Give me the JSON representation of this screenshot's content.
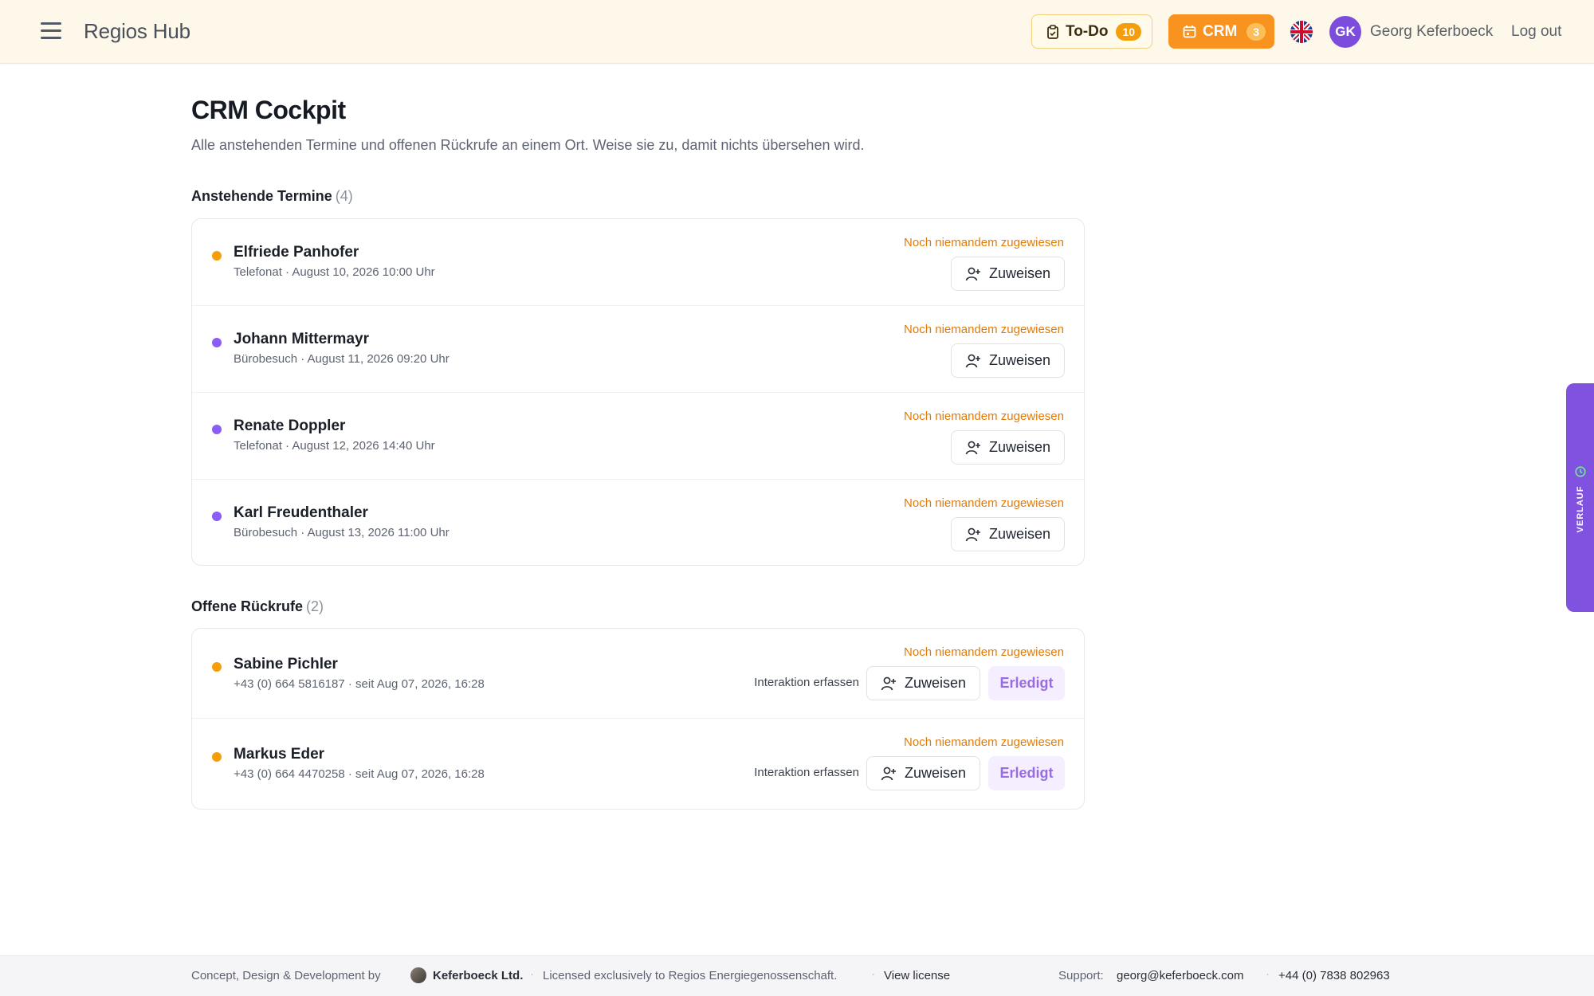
{
  "header": {
    "brand": "Regios Hub",
    "todo": {
      "label": "To-Do",
      "count": "10"
    },
    "crm": {
      "label": "CRM",
      "count": "3"
    },
    "avatar_initials": "GK",
    "user_name": "Georg Keferboeck",
    "logout": "Log out"
  },
  "page": {
    "title": "CRM Cockpit",
    "subtitle": "Alle anstehenden Termine und offenen Rückrufe an einem Ort. Weise sie zu, damit nichts übersehen wird."
  },
  "appointments": {
    "title": "Anstehende Termine",
    "count": "(4)",
    "items": [
      {
        "name": "Elfriede Panhofer",
        "meta": "Telefonat · August 10, 2026 10:00 Uhr",
        "status": "Noch niemandem zugewiesen",
        "assign": "Zuweisen",
        "dot": "#f59e0b"
      },
      {
        "name": "Johann Mittermayr",
        "meta": "Bürobesuch · August 11, 2026 09:20 Uhr",
        "status": "Noch niemandem zugewiesen",
        "assign": "Zuweisen",
        "dot": "#8b5cf6"
      },
      {
        "name": "Renate Doppler",
        "meta": "Telefonat · August 12, 2026 14:40 Uhr",
        "status": "Noch niemandem zugewiesen",
        "assign": "Zuweisen",
        "dot": "#8b5cf6"
      },
      {
        "name": "Karl Freudenthaler",
        "meta": "Bürobesuch · August 13, 2026 11:00 Uhr",
        "status": "Noch niemandem zugewiesen",
        "assign": "Zuweisen",
        "dot": "#8b5cf6"
      }
    ]
  },
  "callbacks": {
    "title": "Offene Rückrufe",
    "count": "(2)",
    "items": [
      {
        "name": "Sabine Pichler",
        "meta": "+43 (0) 664 5816187 · seit Aug 07, 2026, 16:28",
        "status": "Noch niemandem zugewiesen",
        "interaction": "Interaktion erfassen",
        "assign": "Zuweisen",
        "done": "Erledigt",
        "dot": "#f59e0b"
      },
      {
        "name": "Markus Eder",
        "meta": "+43 (0) 664 4470258 · seit Aug 07, 2026, 16:28",
        "status": "Noch niemandem zugewiesen",
        "interaction": "Interaktion erfassen",
        "assign": "Zuweisen",
        "done": "Erledigt",
        "dot": "#f59e0b"
      }
    ]
  },
  "side_tab": {
    "label": "VERLAUF"
  },
  "footer": {
    "concept": "Concept, Design & Development by",
    "company": "Keferboeck Ltd.",
    "licensed": "Licensed exclusively to Regios Energiegenossenschaft.",
    "view_license": "View license",
    "support_label": "Support:",
    "support_email": "georg@keferboeck.com",
    "phone": "+44 (0) 7838 802963"
  },
  "colors": {
    "accent": "#f7931e",
    "header_bg": "#fdf8ea",
    "status_orange": "#e07b0a",
    "purple": "#8152e0"
  },
  "icons": [
    "menu-icon",
    "clipboard-icon",
    "calendar-icon",
    "uk-flag-icon",
    "user-plus-icon",
    "clock-icon"
  ]
}
